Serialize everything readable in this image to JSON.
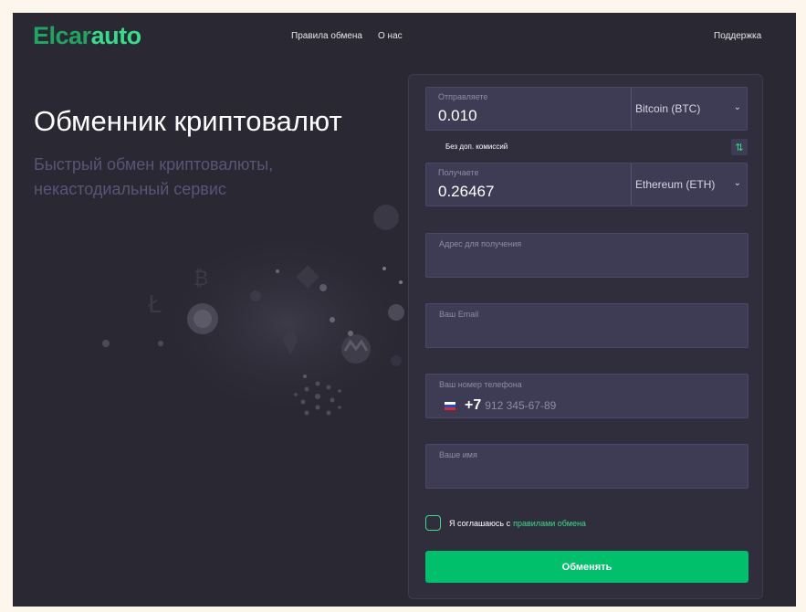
{
  "header": {
    "logo_part1": "Elcar",
    "logo_part2": "auto",
    "nav_rules": "Правила обмена",
    "nav_about": "О нас",
    "nav_support": "Поддержка"
  },
  "hero": {
    "title": "Обменник криптовалют",
    "subtitle": "Быстрый обмен криптовалюты, некастодиальный сервис"
  },
  "exchange": {
    "send": {
      "label": "Отправляете",
      "amount": "0.010",
      "currency": "Bitcoin (BTC)"
    },
    "fee_note": "Без доп. комиссий",
    "swap_icon": "⇅",
    "receive": {
      "label": "Получаете",
      "amount": "0.26467",
      "currency": "Ethereum (ETH)"
    },
    "fields": {
      "address_label": "Адрес для получения",
      "email_label": "Ваш Email",
      "phone_label": "Ваш номер телефона",
      "phone_code": "+7",
      "phone_placeholder": "912 345-67-89",
      "name_label": "Ваше имя"
    },
    "agree_text": "Я соглашаюсь с",
    "agree_link": "правилами обмена",
    "submit": "Обменять"
  },
  "colors": {
    "background": "#2a2833",
    "panel": "#302e3c",
    "input": "#3e3b55",
    "accent": "#35dd88",
    "button": "#00c06b",
    "subtitle": "#5a5476"
  },
  "icons": {
    "swap": "swap-arrows-icon",
    "select": "chevron-down-icon",
    "flag": "russia-flag-icon"
  }
}
